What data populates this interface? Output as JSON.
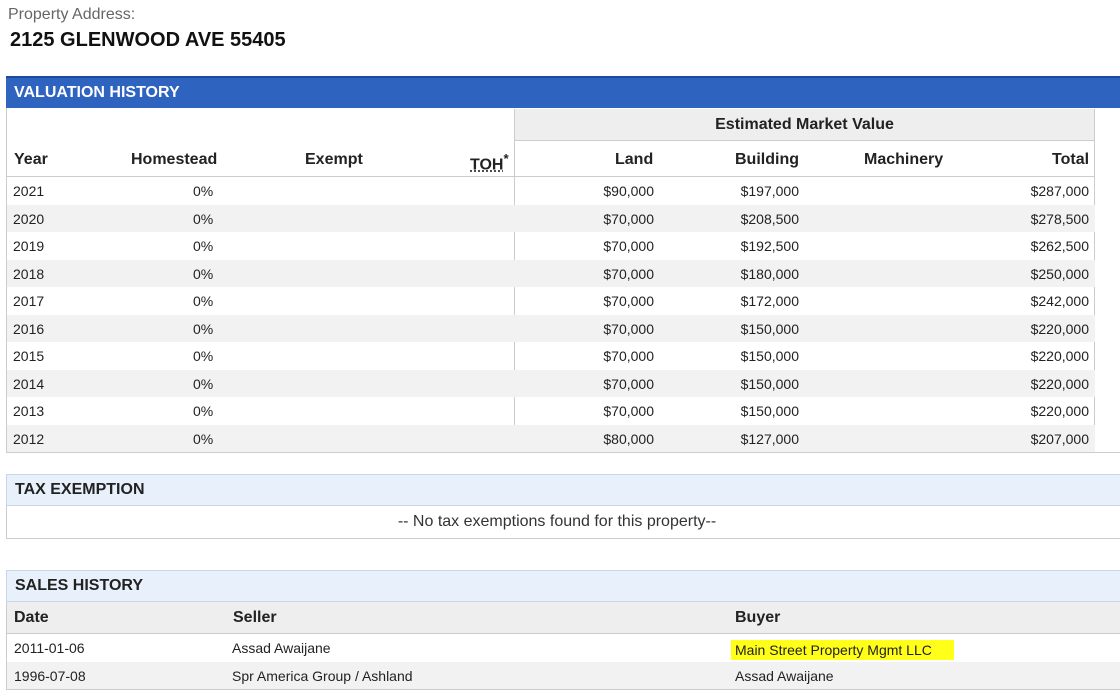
{
  "property": {
    "label": "Property Address:",
    "address": "2125 GLENWOOD AVE 55405"
  },
  "valuation": {
    "title": "VALUATION HISTORY",
    "group_header": "Estimated Market Value",
    "columns": {
      "year": "Year",
      "homestead": "Homestead",
      "exempt": "Exempt",
      "toh": "TOH",
      "toh_marker": "*",
      "land": "Land",
      "building": "Building",
      "machinery": "Machinery",
      "total": "Total"
    },
    "rows": [
      {
        "year": "2021",
        "homestead": "0%",
        "land": "$90,000",
        "building": "$197,000",
        "total": "$287,000"
      },
      {
        "year": "2020",
        "homestead": "0%",
        "land": "$70,000",
        "building": "$208,500",
        "total": "$278,500"
      },
      {
        "year": "2019",
        "homestead": "0%",
        "land": "$70,000",
        "building": "$192,500",
        "total": "$262,500"
      },
      {
        "year": "2018",
        "homestead": "0%",
        "land": "$70,000",
        "building": "$180,000",
        "total": "$250,000"
      },
      {
        "year": "2017",
        "homestead": "0%",
        "land": "$70,000",
        "building": "$172,000",
        "total": "$242,000"
      },
      {
        "year": "2016",
        "homestead": "0%",
        "land": "$70,000",
        "building": "$150,000",
        "total": "$220,000"
      },
      {
        "year": "2015",
        "homestead": "0%",
        "land": "$70,000",
        "building": "$150,000",
        "total": "$220,000"
      },
      {
        "year": "2014",
        "homestead": "0%",
        "land": "$70,000",
        "building": "$150,000",
        "total": "$220,000"
      },
      {
        "year": "2013",
        "homestead": "0%",
        "land": "$70,000",
        "building": "$150,000",
        "total": "$220,000"
      },
      {
        "year": "2012",
        "homestead": "0%",
        "land": "$80,000",
        "building": "$127,000",
        "total": "$207,000"
      }
    ]
  },
  "tax_exemption": {
    "title": "TAX EXEMPTION",
    "message": "-- No tax exemptions found for this property--"
  },
  "sales": {
    "title": "SALES HISTORY",
    "columns": {
      "date": "Date",
      "seller": "Seller",
      "buyer": "Buyer"
    },
    "rows": [
      {
        "date": "2011-01-06",
        "seller": "Assad Awaijane",
        "buyer": "Main Street Property Mgmt LLC"
      },
      {
        "date": "1996-07-08",
        "seller": "Spr America Group / Ashland",
        "buyer": "Assad Awaijane"
      }
    ],
    "highlight_color": "#ffff1a"
  },
  "colors": {
    "header_blue": "#2e63c0",
    "section_bg": "#e8f1fb"
  }
}
